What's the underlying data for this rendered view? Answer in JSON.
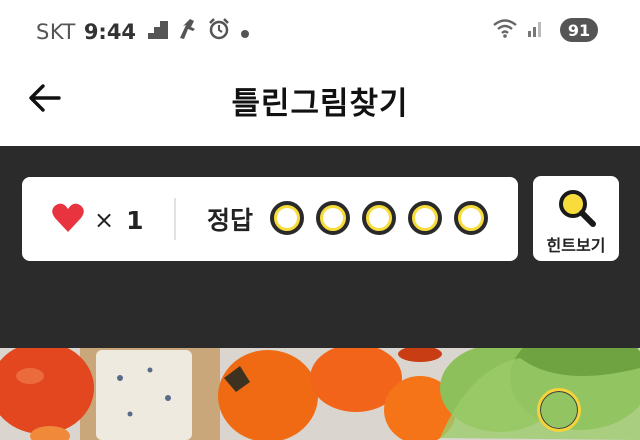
{
  "status_bar": {
    "carrier": "SKT",
    "time": "9:44",
    "battery": "91"
  },
  "header": {
    "title": "틀린그림찾기",
    "back_icon": "arrow-left-icon"
  },
  "game": {
    "lives_icon": "heart-icon",
    "lives_multiplier": "×",
    "lives_count": "1",
    "answer_label": "정답",
    "answers_found": 0,
    "answers_total": 5,
    "hint_icon": "magnifier-icon",
    "hint_label": "힌트보기"
  },
  "colors": {
    "accent_yellow": "#f7dc3b",
    "panel_dark": "#2b2b2b",
    "heart_red": "#e8343f"
  }
}
